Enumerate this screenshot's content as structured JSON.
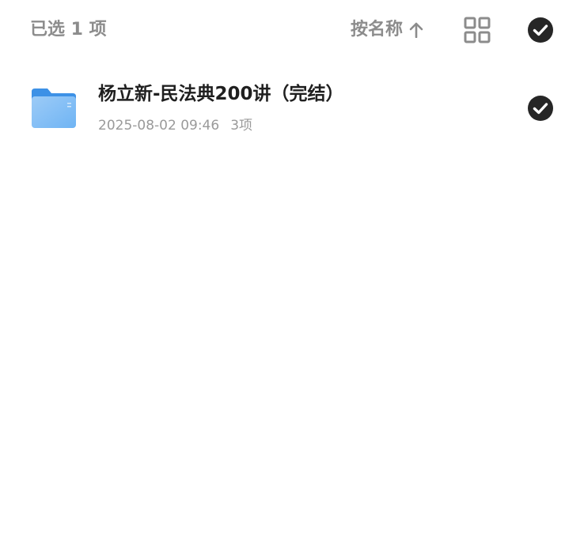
{
  "header": {
    "selected_count": "已选 1 项",
    "sort_label": "按名称",
    "sort_direction_icon": "arrow-up-icon",
    "view_toggle_icon": "grid-view-icon",
    "select_all_icon": "check-circle-icon"
  },
  "colors": {
    "header_text": "#8c8c8c",
    "title_text": "#1f1f1f",
    "meta_text": "#9a9a9a",
    "check_fill": "#262626",
    "folder_blue": "#5aa8f2"
  },
  "file_list": {
    "items": [
      {
        "title": "杨立新-民法典200讲（完结）",
        "date": "2025-08-02 09:46",
        "count": "3项",
        "icon": "folder-icon",
        "selected": true
      }
    ]
  }
}
